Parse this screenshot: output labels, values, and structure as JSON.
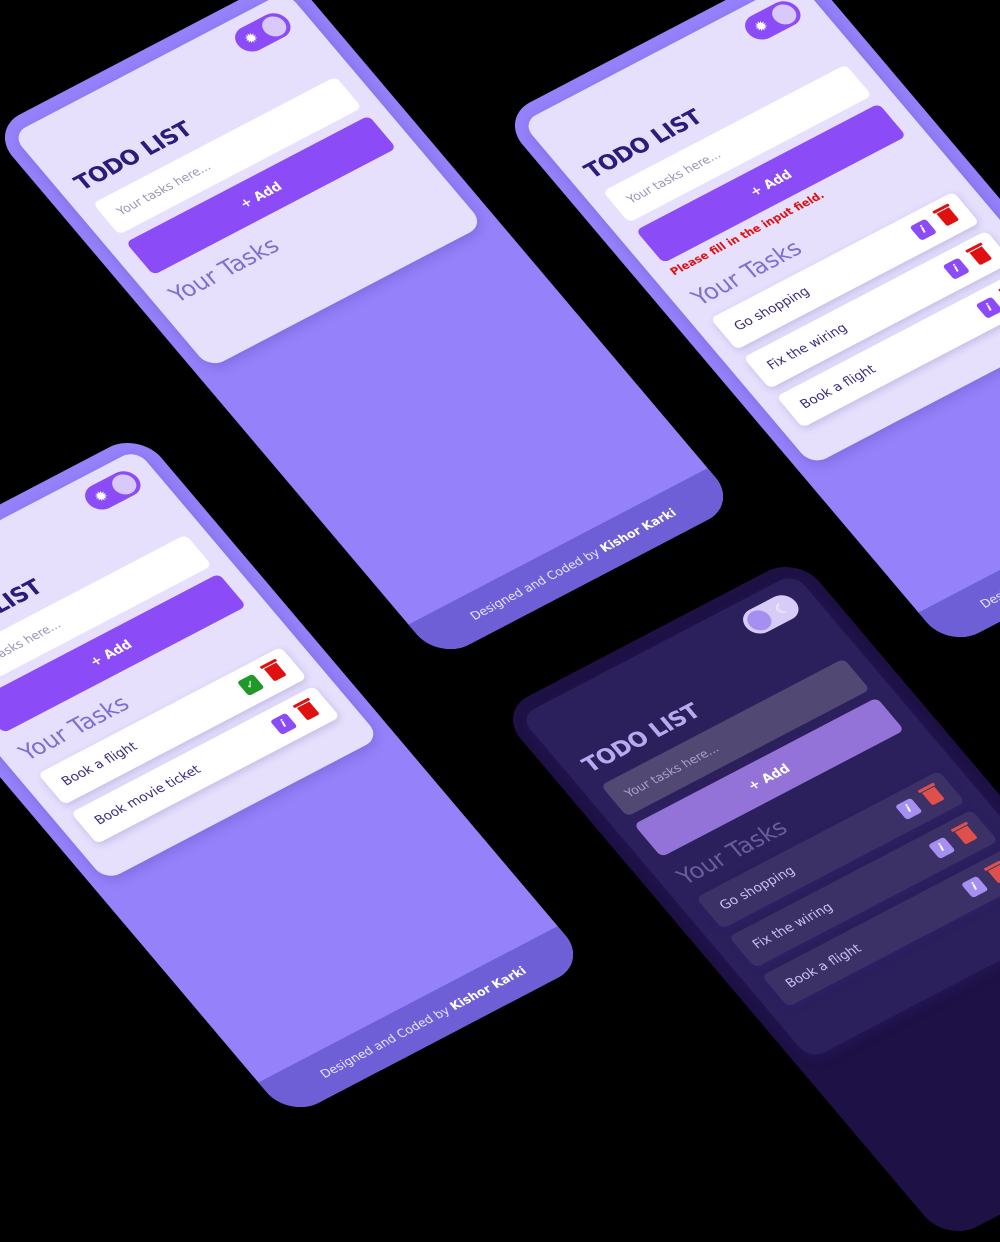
{
  "common": {
    "title": "TODO LIST",
    "placeholder": "Your tasks here...",
    "add_label": "+ Add",
    "section": "Your Tasks",
    "footer_prefix": "Designed and Coded by",
    "footer_author": "Kishor Karki",
    "sun": "✹",
    "moon": "☾",
    "edit": "i",
    "done": "✓"
  },
  "phone_top_right": {
    "error": "Please fill in the input field.",
    "tasks": [
      "Go shopping",
      "Fix the wiring",
      "Book a flight"
    ]
  },
  "phone_left": {
    "tasks": [
      "Book a flight",
      "Book movie ticket"
    ]
  },
  "phone_dark": {
    "tasks": [
      "Go shopping",
      "Fix the wiring",
      "Book a flight"
    ]
  },
  "colors": {
    "accent": "#8b4cf7",
    "phone": "#9582fb",
    "card": "#e6e0fd",
    "error": "#e01010",
    "done": "#1f9a2a"
  }
}
